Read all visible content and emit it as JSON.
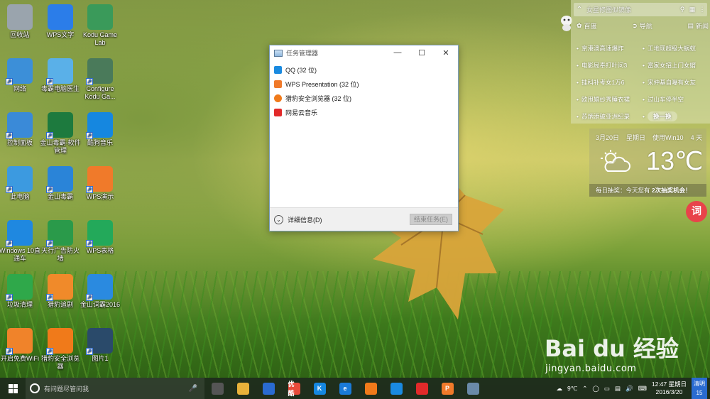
{
  "desktop_icons": [
    {
      "label": "回收站",
      "icon": "recycle-bin-icon",
      "color": "#9aa4ad"
    },
    {
      "label": "WPS文字",
      "icon": "wps-writer-icon",
      "color": "#2b7de9"
    },
    {
      "label": "Kodu Game Lab",
      "icon": "kodu-icon",
      "color": "#3a9a5a"
    },
    {
      "label": "网络",
      "icon": "network-icon",
      "color": "#3c8fd8"
    },
    {
      "label": "毒霸电脑医生",
      "icon": "doctor-icon",
      "color": "#5ab0e8"
    },
    {
      "label": "Configure Kodu Ga...",
      "icon": "kodu-config-icon",
      "color": "#4a7a5a"
    },
    {
      "label": "控制面板",
      "icon": "control-panel-icon",
      "color": "#3a8ad8"
    },
    {
      "label": "金山毒霸-软件管理",
      "icon": "software-manager-icon",
      "color": "#1d7a3e"
    },
    {
      "label": "酷狗音乐",
      "icon": "kugou-icon",
      "color": "#1587e0"
    },
    {
      "label": "此电脑",
      "icon": "this-pc-icon",
      "color": "#3c9ae0"
    },
    {
      "label": "金山毒霸",
      "icon": "duba-icon",
      "color": "#2a84d8"
    },
    {
      "label": "WPS演示",
      "icon": "wps-presentation-icon",
      "color": "#f07a2a"
    },
    {
      "label": "Windows 10直通车",
      "icon": "win10-icon",
      "color": "#1f88e0"
    },
    {
      "label": "天行广告防火墙",
      "icon": "ad-firewall-icon",
      "color": "#2a9a4a"
    },
    {
      "label": "WPS表格",
      "icon": "wps-spreadsheet-icon",
      "color": "#23a95a"
    },
    {
      "label": "垃圾清理",
      "icon": "cleanup-icon",
      "color": "#2fa84a"
    },
    {
      "label": "猎豹追剧",
      "icon": "video-icon",
      "color": "#f08a2a"
    },
    {
      "label": "金山词霸2016",
      "icon": "powerword-icon",
      "color": "#2a8ae0"
    },
    {
      "label": "开启免费WiFi",
      "icon": "wifi-icon",
      "color": "#f0832a"
    },
    {
      "label": "猎豹安全浏览器",
      "icon": "liebao-browser-icon",
      "color": "#f07a1a"
    },
    {
      "label": "图片1",
      "icon": "image-file-icon",
      "color": "#2a4a6a"
    }
  ],
  "task_manager": {
    "title": "任务管理器",
    "apps": [
      {
        "name": "QQ (32 位)",
        "icon": "qq-icon",
        "color": "#1a8ae0"
      },
      {
        "name": "WPS Presentation (32 位)",
        "icon": "wps-presentation-icon",
        "color": "#f07a2a"
      },
      {
        "name": "猎豹安全浏览器 (32 位)",
        "icon": "liebao-browser-icon",
        "color": "#f07a1a"
      },
      {
        "name": "网易云音乐",
        "icon": "netease-music-icon",
        "color": "#e22a2a"
      }
    ],
    "details_label": "详细信息(D)",
    "end_task_label": "结束任务(E)"
  },
  "news_panel": {
    "search_placeholder": "女星修图似镜像",
    "nav": [
      "百度",
      "导航",
      "新闻"
    ],
    "links": [
      [
        "京港澳高速爆炸",
        "工地现超级大蜗蚁"
      ],
      [
        "电影局奉打叶问3",
        "富家女招上门女婿"
      ],
      [
        "挂科补考女1万6",
        "宋仲基自曝有女友"
      ],
      [
        "欧甩婚纱秀睡衣裙",
        "过山车停半空"
      ],
      [
        "苏炳添破亚洲纪录",
        ""
      ]
    ],
    "swap_label": "换一换"
  },
  "weather": {
    "date": "3月20日",
    "weekday": "星期日",
    "usage": "使用Win10",
    "days": "4 天",
    "temp": "13℃",
    "ticker": "每日抽奖：今天您有",
    "ticker_bold": "2次抽奖机会！"
  },
  "ci_button": "词",
  "watermark": {
    "line1": "Bai du 经验",
    "line2": "jingyan.baidu.com"
  },
  "taskbar": {
    "search_placeholder": "有问题尽管问我",
    "pinned": [
      {
        "name": "task-view-icon",
        "color": "#555",
        "text": ""
      },
      {
        "name": "file-explorer-icon",
        "color": "#e8b23a",
        "text": ""
      },
      {
        "name": "store-icon",
        "color": "#2a6bd1",
        "text": ""
      },
      {
        "name": "youku-icon",
        "color": "#e84a3a",
        "text": "优酷"
      },
      {
        "name": "kugou-icon",
        "color": "#1587e0",
        "text": "K"
      },
      {
        "name": "edge-icon",
        "color": "#1a7ad8",
        "text": "e"
      },
      {
        "name": "liebao-browser-icon",
        "color": "#f07a1a",
        "text": ""
      },
      {
        "name": "qq-icon",
        "color": "#1a8ae0",
        "text": ""
      },
      {
        "name": "netease-music-icon",
        "color": "#e22a2a",
        "text": ""
      },
      {
        "name": "wps-presentation-icon",
        "color": "#f07a2a",
        "text": "P"
      },
      {
        "name": "task-manager-icon",
        "color": "#6a8aa8",
        "text": ""
      }
    ],
    "weather": "9℃",
    "time": "12:47 星期日",
    "date": "2016/3/20",
    "notif_top": "清明",
    "notif_bottom": "15"
  }
}
